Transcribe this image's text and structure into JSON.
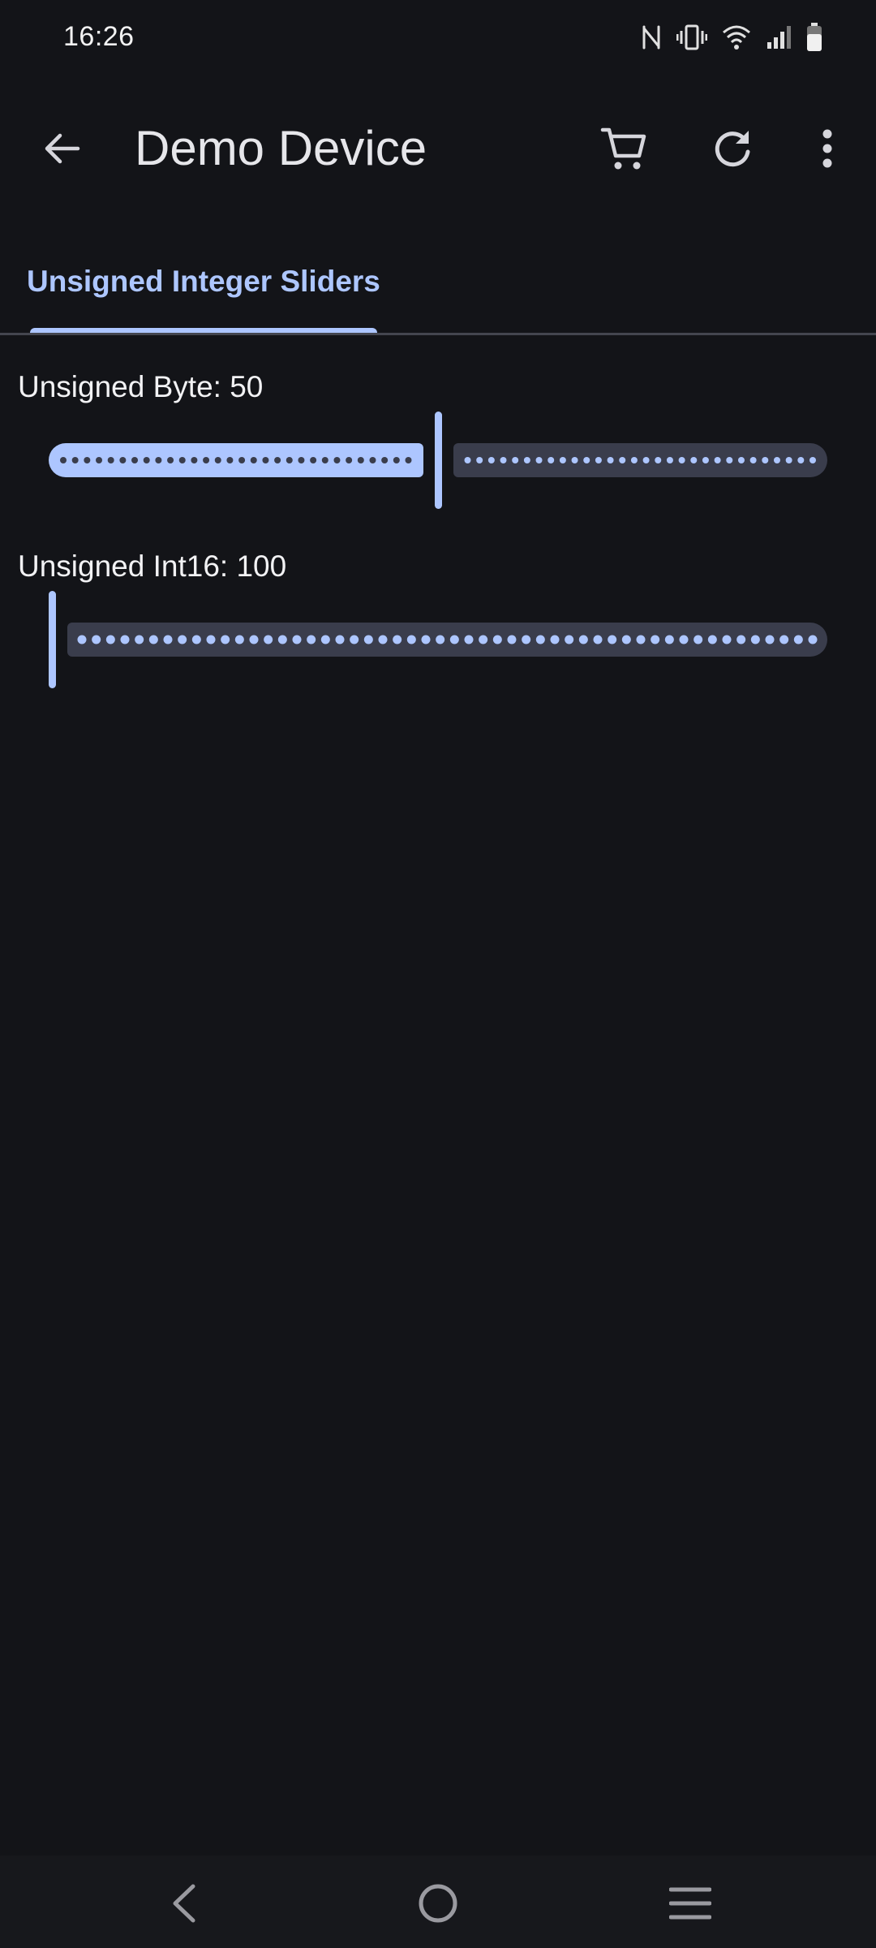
{
  "status_bar": {
    "time": "16:26",
    "icons": [
      "nfc-icon",
      "vibrate-icon",
      "wifi-icon",
      "signal-icon",
      "battery-icon"
    ]
  },
  "app_bar": {
    "title": "Demo Device",
    "icons": [
      "back-arrow-icon",
      "cart-icon",
      "refresh-icon",
      "more-vert-icon"
    ]
  },
  "tabs": [
    {
      "label": "Unsigned Integer Sliders",
      "selected": true
    }
  ],
  "sliders": [
    {
      "label": "Unsigned Byte: 50",
      "value_fraction": 0.5
    },
    {
      "label": "Unsigned Int16: 100",
      "value_fraction": 0.0
    }
  ],
  "colors": {
    "accent": "#adc6ff",
    "background": "#131418",
    "inactive_track": "#3a3d4c",
    "tick_on_active": "#3a3d4c"
  },
  "nav_bar": {
    "icons": [
      "nav-back-icon",
      "nav-home-icon",
      "nav-recents-icon"
    ]
  }
}
